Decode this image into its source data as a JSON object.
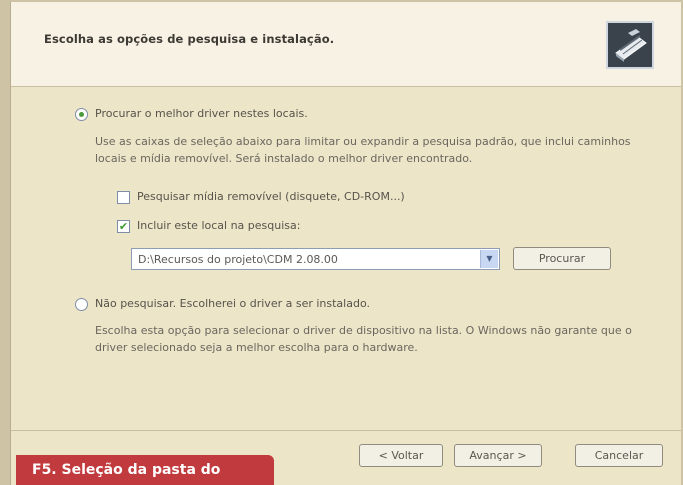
{
  "header": {
    "title": "Escolha as opções de pesquisa e instalação."
  },
  "option_search": {
    "label": "Procurar o melhor driver nestes locais.",
    "description": "Use as caixas de seleção abaixo para limitar ou expandir a pesquisa padrão, que inclui caminhos locais e mídia removível. Será instalado o melhor driver encontrado.",
    "checkbox_removable": "Pesquisar mídia removível (disquete, CD-ROM...)",
    "checkbox_location": "Incluir este local na pesquisa:",
    "location_value": "D:\\Recursos do projeto\\CDM 2.08.00",
    "browse_button": "Procurar"
  },
  "option_no_search": {
    "label": "Não pesquisar. Escolherei o driver a ser instalado.",
    "description": "Escolha esta opção para selecionar o driver de dispositivo na lista. O Windows não garante que o driver selecionado seja a melhor escolha para o hardware."
  },
  "footer": {
    "back_button": "< Voltar",
    "next_button": "Avançar >",
    "cancel_button": "Cancelar"
  },
  "caption": {
    "text": "F5. Seleção da pasta do"
  },
  "colors": {
    "caption_bg": "#c13a3d",
    "accent_green": "#4b9a3c"
  }
}
